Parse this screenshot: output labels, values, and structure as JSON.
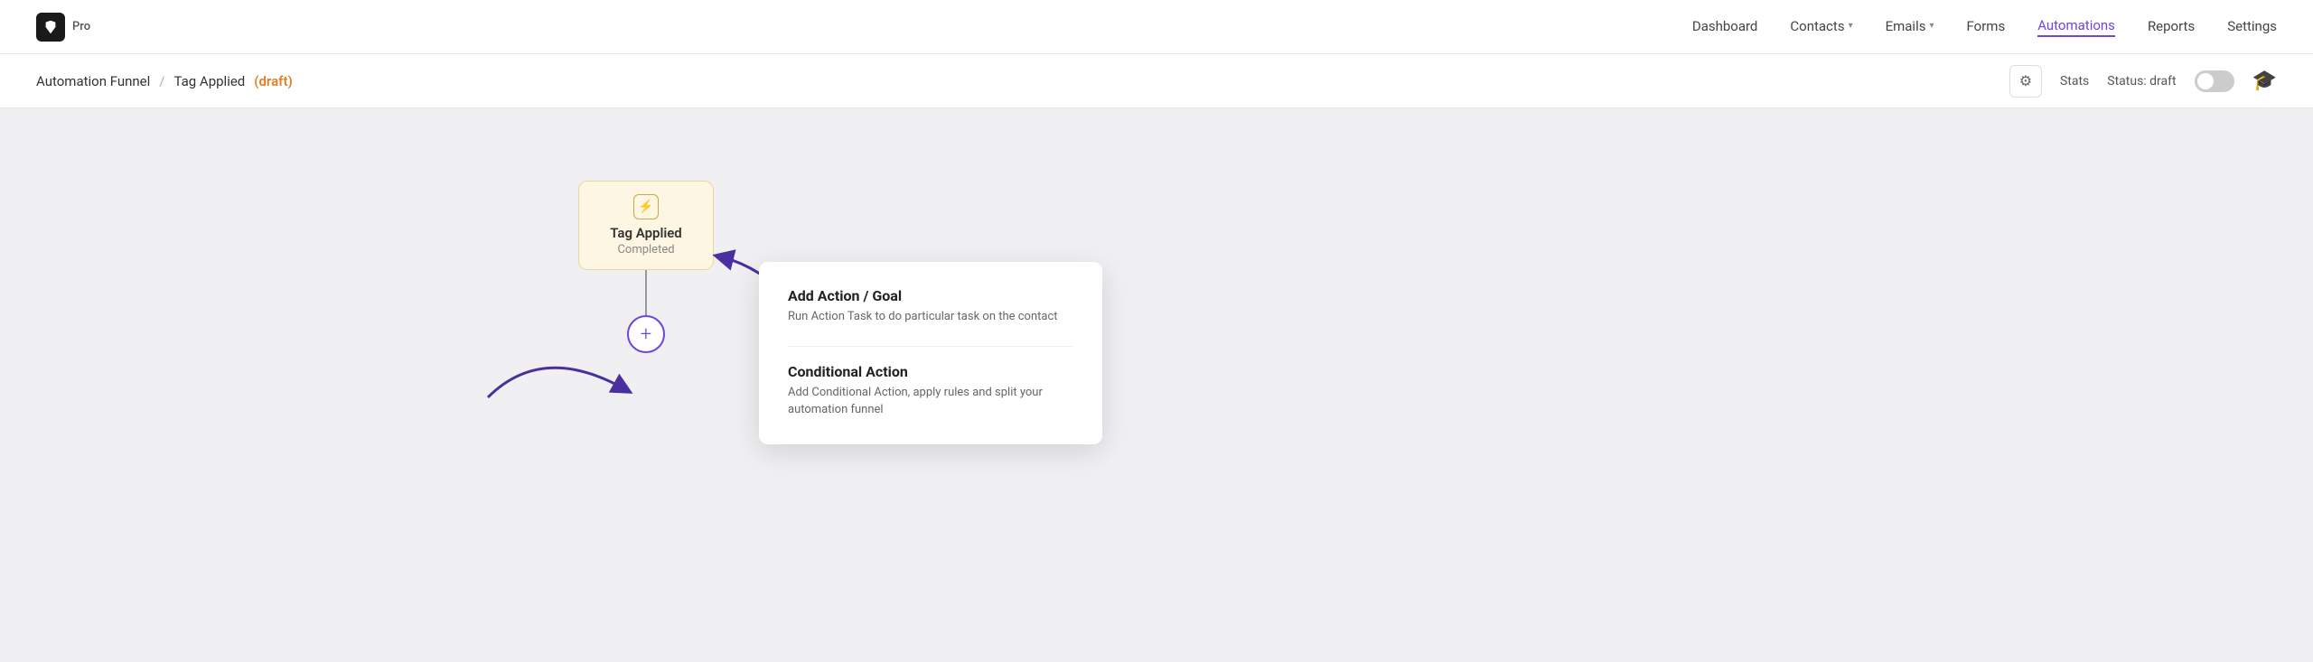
{
  "logo": {
    "text": "Pro"
  },
  "nav": {
    "items": [
      {
        "label": "Dashboard",
        "active": false,
        "hasDropdown": false
      },
      {
        "label": "Contacts",
        "active": false,
        "hasDropdown": true
      },
      {
        "label": "Emails",
        "active": false,
        "hasDropdown": true
      },
      {
        "label": "Forms",
        "active": false,
        "hasDropdown": false
      },
      {
        "label": "Automations",
        "active": true,
        "hasDropdown": false
      },
      {
        "label": "Reports",
        "active": false,
        "hasDropdown": false
      },
      {
        "label": "Settings",
        "active": false,
        "hasDropdown": false
      }
    ]
  },
  "subheader": {
    "breadcrumb_root": "Automation Funnel",
    "breadcrumb_sep": "/",
    "breadcrumb_child": "Tag Applied",
    "draft_label": "(draft)",
    "stats_label": "Stats",
    "status_label": "Status: draft"
  },
  "node": {
    "title": "Tag Applied",
    "subtitle": "Completed",
    "icon": "⚡"
  },
  "popup": {
    "item1_title": "Add Action / Goal",
    "item1_desc": "Run Action Task to do particular task on the contact",
    "item2_title": "Conditional Action",
    "item2_desc": "Add Conditional Action, apply rules and split your automation funnel"
  }
}
